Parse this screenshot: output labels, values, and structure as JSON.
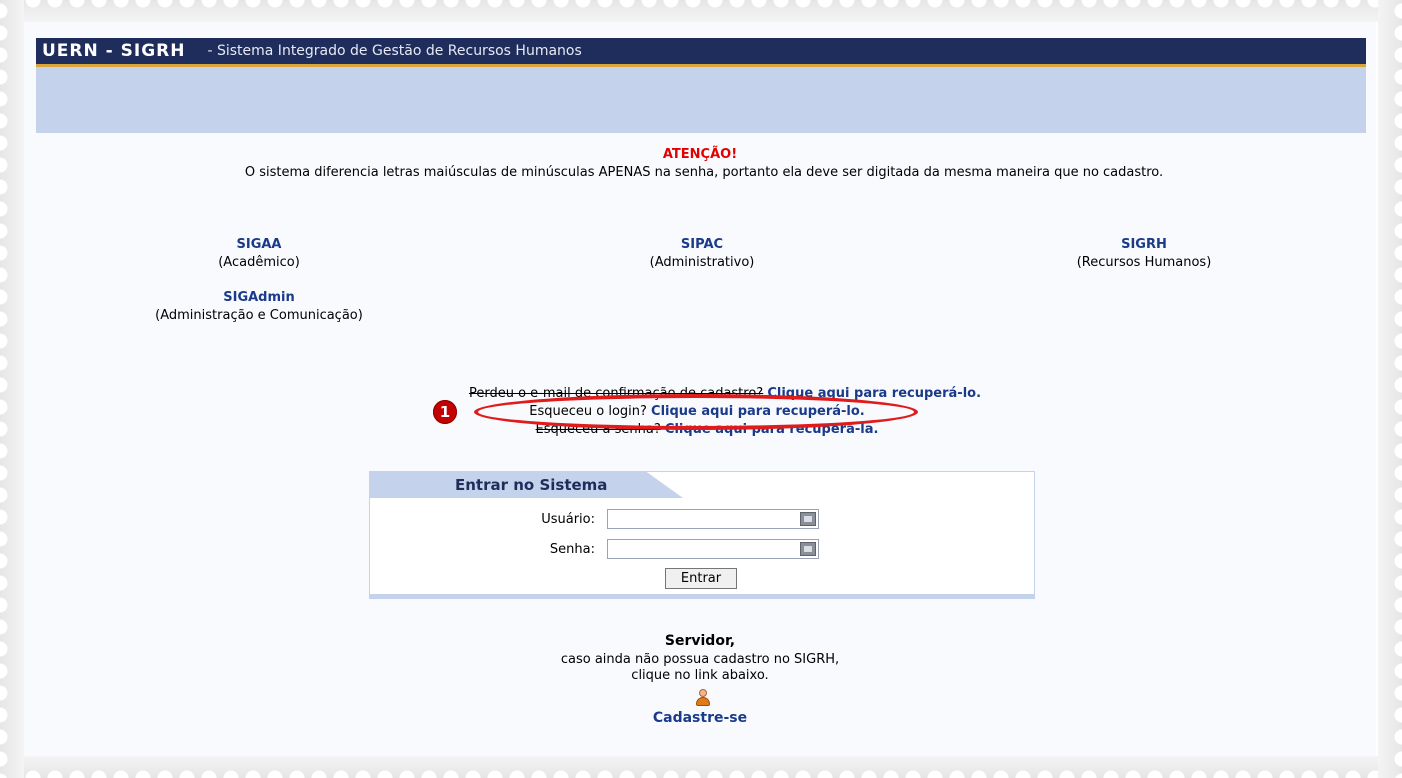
{
  "header": {
    "system_name": "UERN - SIGRH",
    "description": "- Sistema Integrado de Gestão de Recursos Humanos"
  },
  "attention": {
    "title": "ATENÇÃO!",
    "text": "O sistema diferencia letras maiúsculas de minúsculas APENAS na senha, portanto ela deve ser digitada da mesma maneira que no cadastro."
  },
  "systems": [
    {
      "name": "SIGAA",
      "subtitle": "(Acadêmico)"
    },
    {
      "name": "SIPAC",
      "subtitle": "(Administrativo)"
    },
    {
      "name": "SIGRH",
      "subtitle": "(Recursos Humanos)"
    },
    {
      "name": "SIGAdmin",
      "subtitle": "(Administração e Comunicação)"
    }
  ],
  "recovery": {
    "email_text": "Perdeu o e-mail de confirmação de cadastro?",
    "email_link": "Clique aqui para recuperá-lo.",
    "login_text": "Esqueceu o login?",
    "login_link": "Clique aqui para recuperá-lo.",
    "password_text": "Esqueceu a senha?",
    "password_link": "Clique aqui para recuperá-la.",
    "marker": "1"
  },
  "login_form": {
    "title": "Entrar no Sistema",
    "user_label": "Usuário:",
    "user_value": "",
    "password_label": "Senha:",
    "password_value": "",
    "submit_label": "Entrar"
  },
  "servidor": {
    "title": "Servidor,",
    "line1": "caso ainda não possua cadastro no SIGRH,",
    "line2": "clique no link abaixo.",
    "register_link": "Cadastre-se"
  },
  "colors": {
    "header_bar": "#1f2d5c",
    "header_accent": "#d9a43a",
    "band": "#c5d2eb",
    "link": "#1a3a8a",
    "attention": "#e20000",
    "highlight": "#e01b1b"
  }
}
